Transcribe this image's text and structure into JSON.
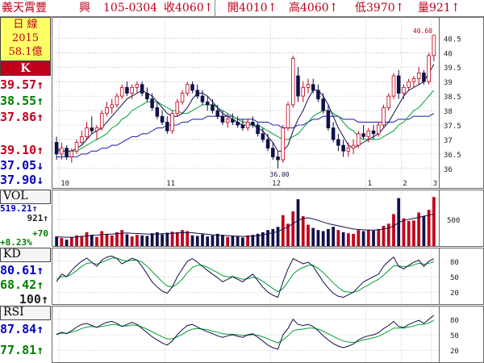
{
  "header": {
    "name": "義天霄豐",
    "tag": "興",
    "date": "105-0304",
    "close": "收4060↑",
    "open": "開4010↑",
    "high": "高4060↑",
    "low": "低3970↑",
    "volume": "量921↑"
  },
  "info_box": {
    "line1": "日 線",
    "line2": "2015",
    "line3": "58.1億"
  },
  "k_panel": {
    "label": "K",
    "values": [
      "39.57↑",
      "38.55↑",
      "37.86↑",
      "39.10↑",
      "37.05↓",
      "37.90↓"
    ],
    "colors": [
      "#c0001a",
      "#008000",
      "#c0001a",
      "#c0001a",
      "#0000c0",
      "#0000c0"
    ]
  },
  "vol_panel": {
    "label": "VOL",
    "values": [
      "519.21↑",
      "921↑"
    ],
    "change": "+70",
    "pct": "+8.23%"
  },
  "kd_panel": {
    "label": "KD",
    "values": [
      "80.61↑",
      "68.42↑",
      "100↑"
    ]
  },
  "rsi_panel": {
    "label": "RSI",
    "values": [
      "87.84↑",
      "77.81↑"
    ]
  },
  "colors": {
    "up": "#c0001a",
    "down": "#10104a",
    "ma_short": "#10104a",
    "ma_mid": "#00a030",
    "ma_long": "#3030b0",
    "grid": "#999999"
  },
  "chart_data": [
    {
      "type": "candlestick",
      "price_ticks": [
        36,
        36.5,
        37,
        37.5,
        38,
        38.5,
        39,
        39.5,
        40,
        40.5
      ],
      "ylim": [
        35.8,
        40.9
      ],
      "month_ticks": [
        "10",
        "11",
        "12",
        "1",
        "2",
        "3"
      ],
      "annotations": [
        {
          "text": "40.60"
        },
        {
          "text": "36.00"
        }
      ],
      "ohlc": [
        [
          36.9,
          37.1,
          36.3,
          36.5
        ],
        [
          36.5,
          36.9,
          36.3,
          36.7
        ],
        [
          36.7,
          36.8,
          36.3,
          36.4
        ],
        [
          36.4,
          36.7,
          36.2,
          36.6
        ],
        [
          36.6,
          37.0,
          36.5,
          36.9
        ],
        [
          36.9,
          37.3,
          36.8,
          37.1
        ],
        [
          37.1,
          37.6,
          37.0,
          37.4
        ],
        [
          37.4,
          37.8,
          37.2,
          37.3
        ],
        [
          37.3,
          37.5,
          37.0,
          37.4
        ],
        [
          37.4,
          38.0,
          37.3,
          37.9
        ],
        [
          37.9,
          38.3,
          37.8,
          38.1
        ],
        [
          38.1,
          38.4,
          37.9,
          38.2
        ],
        [
          38.2,
          38.6,
          38.1,
          38.5
        ],
        [
          38.5,
          38.9,
          38.4,
          38.8
        ],
        [
          38.8,
          39.0,
          38.5,
          38.6
        ],
        [
          38.6,
          38.9,
          38.4,
          38.8
        ],
        [
          38.8,
          39.0,
          38.6,
          38.9
        ],
        [
          38.9,
          39.0,
          38.5,
          38.6
        ],
        [
          38.6,
          38.8,
          38.3,
          38.4
        ],
        [
          38.4,
          38.6,
          38.0,
          38.1
        ],
        [
          38.1,
          38.3,
          37.7,
          37.8
        ],
        [
          37.8,
          38.0,
          37.5,
          37.6
        ],
        [
          37.6,
          37.8,
          37.2,
          37.3
        ],
        [
          37.3,
          38.0,
          37.2,
          37.9
        ],
        [
          37.9,
          38.4,
          37.8,
          38.3
        ],
        [
          38.3,
          38.7,
          38.2,
          38.6
        ],
        [
          38.6,
          39.0,
          38.5,
          38.9
        ],
        [
          38.9,
          39.0,
          38.6,
          38.7
        ],
        [
          38.7,
          38.9,
          38.4,
          38.5
        ],
        [
          38.5,
          38.7,
          38.2,
          38.3
        ],
        [
          38.3,
          38.5,
          38.0,
          38.2
        ],
        [
          38.2,
          38.4,
          37.9,
          38.0
        ],
        [
          38.0,
          38.2,
          37.7,
          37.8
        ],
        [
          37.8,
          38.0,
          37.5,
          37.6
        ],
        [
          37.6,
          37.9,
          37.4,
          37.7
        ],
        [
          37.7,
          37.9,
          37.5,
          37.6
        ],
        [
          37.6,
          37.8,
          37.4,
          37.5
        ],
        [
          37.5,
          37.7,
          37.3,
          37.4
        ],
        [
          37.4,
          37.7,
          37.3,
          37.6
        ],
        [
          37.6,
          37.8,
          37.4,
          37.5
        ],
        [
          37.5,
          37.6,
          37.1,
          37.2
        ],
        [
          37.2,
          37.4,
          36.9,
          37.0
        ],
        [
          37.0,
          37.2,
          36.6,
          36.7
        ],
        [
          36.7,
          36.9,
          36.3,
          36.4
        ],
        [
          36.4,
          36.6,
          36.0,
          36.3
        ],
        [
          36.3,
          37.5,
          36.2,
          37.4
        ],
        [
          37.4,
          38.3,
          37.3,
          38.2
        ],
        [
          38.2,
          39.9,
          38.1,
          39.8
        ],
        [
          39.2,
          39.5,
          38.3,
          38.5
        ],
        [
          38.5,
          39.0,
          38.3,
          38.8
        ],
        [
          38.8,
          39.1,
          38.6,
          38.9
        ],
        [
          38.9,
          39.1,
          38.6,
          38.7
        ],
        [
          38.7,
          38.9,
          38.3,
          38.4
        ],
        [
          38.4,
          38.6,
          37.9,
          38.0
        ],
        [
          38.0,
          38.2,
          37.3,
          37.4
        ],
        [
          37.4,
          37.6,
          36.9,
          37.0
        ],
        [
          37.0,
          37.2,
          36.6,
          36.8
        ],
        [
          36.8,
          37.0,
          36.4,
          36.6
        ],
        [
          36.6,
          36.9,
          36.4,
          36.7
        ],
        [
          36.7,
          37.0,
          36.5,
          36.8
        ],
        [
          36.8,
          37.3,
          36.7,
          37.2
        ],
        [
          37.2,
          37.5,
          37.0,
          37.1
        ],
        [
          37.1,
          37.4,
          36.9,
          37.3
        ],
        [
          37.3,
          37.5,
          37.0,
          37.2
        ],
        [
          37.2,
          37.6,
          37.1,
          37.5
        ],
        [
          37.5,
          38.2,
          37.4,
          38.1
        ],
        [
          38.1,
          38.6,
          38.0,
          38.5
        ],
        [
          38.5,
          39.3,
          38.4,
          39.2
        ],
        [
          39.2,
          39.4,
          38.4,
          38.6
        ],
        [
          38.6,
          38.9,
          38.4,
          38.8
        ],
        [
          38.8,
          39.1,
          38.7,
          39.0
        ],
        [
          39.0,
          39.2,
          38.8,
          39.1
        ],
        [
          39.1,
          39.5,
          38.9,
          39.3
        ],
        [
          39.3,
          39.4,
          38.9,
          39.0
        ],
        [
          39.0,
          40.0,
          38.9,
          39.9
        ],
        [
          39.9,
          40.6,
          39.7,
          40.6
        ]
      ],
      "ma_short": [
        36.7,
        36.6,
        36.6,
        36.6,
        36.7,
        36.8,
        37.0,
        37.2,
        37.3,
        37.4,
        37.6,
        37.8,
        38.0,
        38.2,
        38.4,
        38.5,
        38.6,
        38.7,
        38.6,
        38.5,
        38.3,
        38.1,
        37.9,
        37.8,
        37.8,
        37.9,
        38.1,
        38.4,
        38.6,
        38.6,
        38.5,
        38.3,
        38.1,
        37.9,
        37.8,
        37.7,
        37.6,
        37.5,
        37.5,
        37.5,
        37.4,
        37.3,
        37.1,
        36.9,
        36.6,
        36.6,
        36.8,
        37.3,
        37.7,
        38.0,
        38.4,
        38.7,
        38.7,
        38.5,
        38.2,
        37.8,
        37.4,
        37.1,
        36.8,
        36.7,
        36.8,
        36.9,
        37.0,
        37.1,
        37.2,
        37.4,
        37.6,
        37.9,
        38.2,
        38.5,
        38.7,
        38.8,
        38.9,
        39.0,
        39.3,
        39.6
      ],
      "ma_mid": [
        36.6,
        36.6,
        36.6,
        36.6,
        36.6,
        36.7,
        36.8,
        36.9,
        37.0,
        37.1,
        37.2,
        37.4,
        37.5,
        37.7,
        37.8,
        38.0,
        38.1,
        38.2,
        38.3,
        38.3,
        38.3,
        38.2,
        38.1,
        38.0,
        38.0,
        37.9,
        37.9,
        38.0,
        38.1,
        38.2,
        38.2,
        38.2,
        38.1,
        38.0,
        37.9,
        37.8,
        37.7,
        37.6,
        37.6,
        37.5,
        37.5,
        37.4,
        37.3,
        37.2,
        37.1,
        37.0,
        37.0,
        37.1,
        37.2,
        37.4,
        37.6,
        37.8,
        37.9,
        38.0,
        38.0,
        37.9,
        37.8,
        37.6,
        37.4,
        37.3,
        37.1,
        37.0,
        37.0,
        37.0,
        37.0,
        37.1,
        37.2,
        37.3,
        37.5,
        37.6,
        37.8,
        38.0,
        38.1,
        38.3,
        38.5,
        38.7
      ],
      "ma_long": [
        36.4,
        36.4,
        36.4,
        36.4,
        36.4,
        36.5,
        36.5,
        36.6,
        36.6,
        36.7,
        36.7,
        36.8,
        36.8,
        36.9,
        37.0,
        37.1,
        37.1,
        37.2,
        37.2,
        37.3,
        37.4,
        37.4,
        37.5,
        37.5,
        37.5,
        37.6,
        37.6,
        37.7,
        37.7,
        37.7,
        37.8,
        37.8,
        37.8,
        37.8,
        37.8,
        37.8,
        37.7,
        37.7,
        37.7,
        37.7,
        37.6,
        37.6,
        37.6,
        37.5,
        37.5,
        37.4,
        37.4,
        37.4,
        37.5,
        37.5,
        37.6,
        37.7,
        37.7,
        37.8,
        37.8,
        37.8,
        37.8,
        37.7,
        37.7,
        37.7,
        37.6,
        37.6,
        37.6,
        37.6,
        37.6,
        37.6,
        37.6,
        37.6,
        37.7,
        37.7,
        37.7,
        37.8,
        37.8,
        37.8,
        37.8,
        37.9
      ]
    },
    {
      "type": "bar",
      "name": "VOL",
      "ticks": [
        500
      ],
      "ylim": [
        0,
        1000
      ],
      "values": [
        180,
        150,
        120,
        160,
        200,
        190,
        260,
        210,
        170,
        280,
        230,
        200,
        260,
        300,
        220,
        180,
        210,
        200,
        190,
        240,
        260,
        220,
        250,
        270,
        260,
        300,
        280,
        200,
        190,
        220,
        180,
        200,
        230,
        210,
        170,
        190,
        180,
        160,
        200,
        210,
        230,
        260,
        300,
        320,
        360,
        580,
        420,
        650,
        880,
        560,
        400,
        340,
        300,
        280,
        320,
        360,
        300,
        260,
        240,
        230,
        300,
        280,
        310,
        290,
        320,
        380,
        420,
        600,
        900,
        520,
        470,
        480,
        630,
        560,
        680,
        921
      ],
      "up_flags": [
        0,
        1,
        0,
        1,
        1,
        1,
        1,
        0,
        1,
        1,
        1,
        1,
        1,
        1,
        0,
        1,
        1,
        0,
        0,
        0,
        0,
        0,
        0,
        1,
        1,
        1,
        1,
        0,
        0,
        0,
        0,
        0,
        0,
        0,
        1,
        0,
        0,
        0,
        1,
        0,
        0,
        0,
        0,
        0,
        0,
        1,
        1,
        1,
        0,
        1,
        1,
        0,
        0,
        0,
        0,
        0,
        1,
        0,
        1,
        1,
        1,
        0,
        1,
        0,
        1,
        1,
        1,
        1,
        0,
        1,
        1,
        1,
        1,
        0,
        1,
        1
      ],
      "ma": [
        170,
        168,
        165,
        165,
        170,
        180,
        190,
        200,
        205,
        215,
        220,
        225,
        230,
        240,
        245,
        240,
        235,
        230,
        225,
        220,
        225,
        230,
        235,
        240,
        245,
        250,
        255,
        250,
        240,
        230,
        220,
        210,
        205,
        200,
        195,
        190,
        185,
        180,
        180,
        185,
        195,
        210,
        230,
        250,
        270,
        320,
        360,
        420,
        480,
        520,
        530,
        510,
        480,
        450,
        420,
        400,
        380,
        360,
        340,
        320,
        310,
        305,
        300,
        300,
        305,
        320,
        340,
        380,
        440,
        480,
        500,
        520,
        540,
        560,
        580,
        600
      ]
    },
    {
      "type": "line",
      "name": "KD",
      "ticks": [
        20,
        50,
        80
      ],
      "ylim": [
        0,
        100
      ],
      "series": [
        {
          "values": [
            40,
            55,
            50,
            62,
            72,
            80,
            86,
            78,
            70,
            82,
            88,
            90,
            85,
            75,
            80,
            86,
            82,
            70,
            55,
            40,
            30,
            22,
            18,
            30,
            50,
            65,
            80,
            85,
            78,
            70,
            62,
            55,
            48,
            40,
            45,
            50,
            45,
            40,
            48,
            55,
            42,
            30,
            20,
            14,
            10,
            40,
            65,
            85,
            80,
            75,
            78,
            70,
            55,
            40,
            28,
            18,
            12,
            10,
            15,
            20,
            30,
            40,
            45,
            50,
            55,
            70,
            80,
            88,
            70,
            65,
            72,
            78,
            82,
            70,
            80,
            85
          ]
        },
        {
          "values": [
            45,
            50,
            50,
            55,
            62,
            70,
            76,
            77,
            74,
            78,
            82,
            86,
            86,
            82,
            80,
            82,
            82,
            78,
            70,
            60,
            50,
            40,
            32,
            30,
            36,
            45,
            58,
            68,
            72,
            72,
            68,
            63,
            58,
            52,
            50,
            50,
            48,
            45,
            46,
            49,
            47,
            41,
            34,
            27,
            21,
            27,
            40,
            55,
            63,
            68,
            72,
            72,
            66,
            58,
            48,
            38,
            29,
            22,
            20,
            20,
            23,
            29,
            34,
            40,
            45,
            53,
            62,
            71,
            71,
            69,
            70,
            73,
            76,
            74,
            76,
            79
          ]
        }
      ]
    },
    {
      "type": "line",
      "name": "RSI",
      "ticks": [
        20,
        50,
        80
      ],
      "ylim": [
        0,
        100
      ],
      "series": [
        {
          "values": [
            50,
            55,
            52,
            58,
            65,
            70,
            72,
            68,
            64,
            70,
            74,
            76,
            72,
            66,
            70,
            74,
            70,
            62,
            54,
            46,
            40,
            34,
            30,
            38,
            50,
            60,
            68,
            70,
            65,
            60,
            56,
            52,
            48,
            45,
            48,
            50,
            47,
            45,
            50,
            52,
            45,
            38,
            30,
            25,
            22,
            50,
            62,
            80,
            70,
            68,
            70,
            66,
            58,
            48,
            40,
            33,
            28,
            25,
            28,
            32,
            40,
            45,
            48,
            50,
            54,
            62,
            68,
            76,
            66,
            64,
            70,
            74,
            78,
            72,
            80,
            87.84
          ]
        },
        {
          "values": [
            52,
            53,
            53,
            55,
            58,
            62,
            65,
            66,
            65,
            66,
            68,
            70,
            69,
            67,
            67,
            69,
            68,
            65,
            61,
            56,
            51,
            46,
            42,
            42,
            46,
            51,
            57,
            61,
            62,
            61,
            60,
            57,
            55,
            52,
            51,
            51,
            50,
            49,
            49,
            50,
            49,
            46,
            42,
            38,
            34,
            40,
            48,
            58,
            60,
            61,
            63,
            63,
            61,
            57,
            52,
            47,
            42,
            38,
            36,
            35,
            37,
            40,
            42,
            44,
            47,
            52,
            57,
            63,
            63,
            63,
            65,
            67,
            70,
            70,
            73,
            77.81
          ]
        }
      ]
    }
  ]
}
